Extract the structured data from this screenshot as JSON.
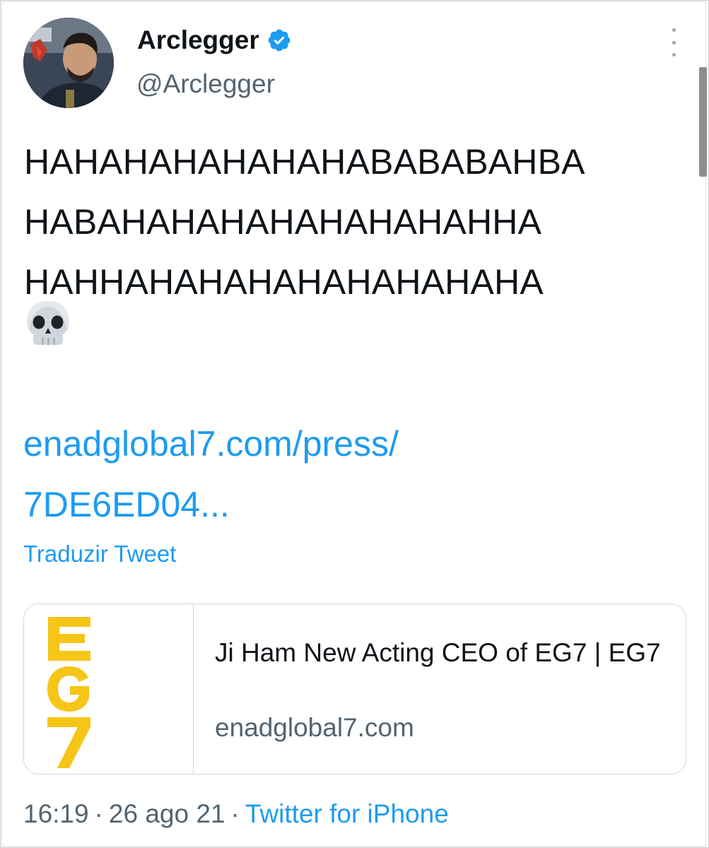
{
  "author": {
    "display_name": "Arclegger",
    "handle": "@Arclegger",
    "verified_icon": "verified-badge-icon",
    "accent_color": "#1d9bf0"
  },
  "tweet": {
    "lines": [
      "HAHAHAHAHAHAHABABABAHBA",
      "HABAHAHAHAHAHAHAHAHHA",
      "HAHHAHAHAHAHAHAHAHAHA"
    ],
    "emoji_icon": "skull-emoji-icon",
    "link_lines": [
      "enadglobal7.com/press/",
      "7DE6ED04..."
    ],
    "translate_label": "Traduzir Tweet"
  },
  "link_card": {
    "thumbnail_text": "EG7",
    "thumbnail_color": "#f5c518",
    "title": "Ji Ham New Acting CEO of EG7 | EG7",
    "domain": "enadglobal7.com"
  },
  "meta": {
    "time": "16:19",
    "date": "26 ago 21",
    "separator": "·",
    "source": "Twitter for iPhone"
  },
  "menu": {
    "more_icon": "more-vertical-icon"
  }
}
